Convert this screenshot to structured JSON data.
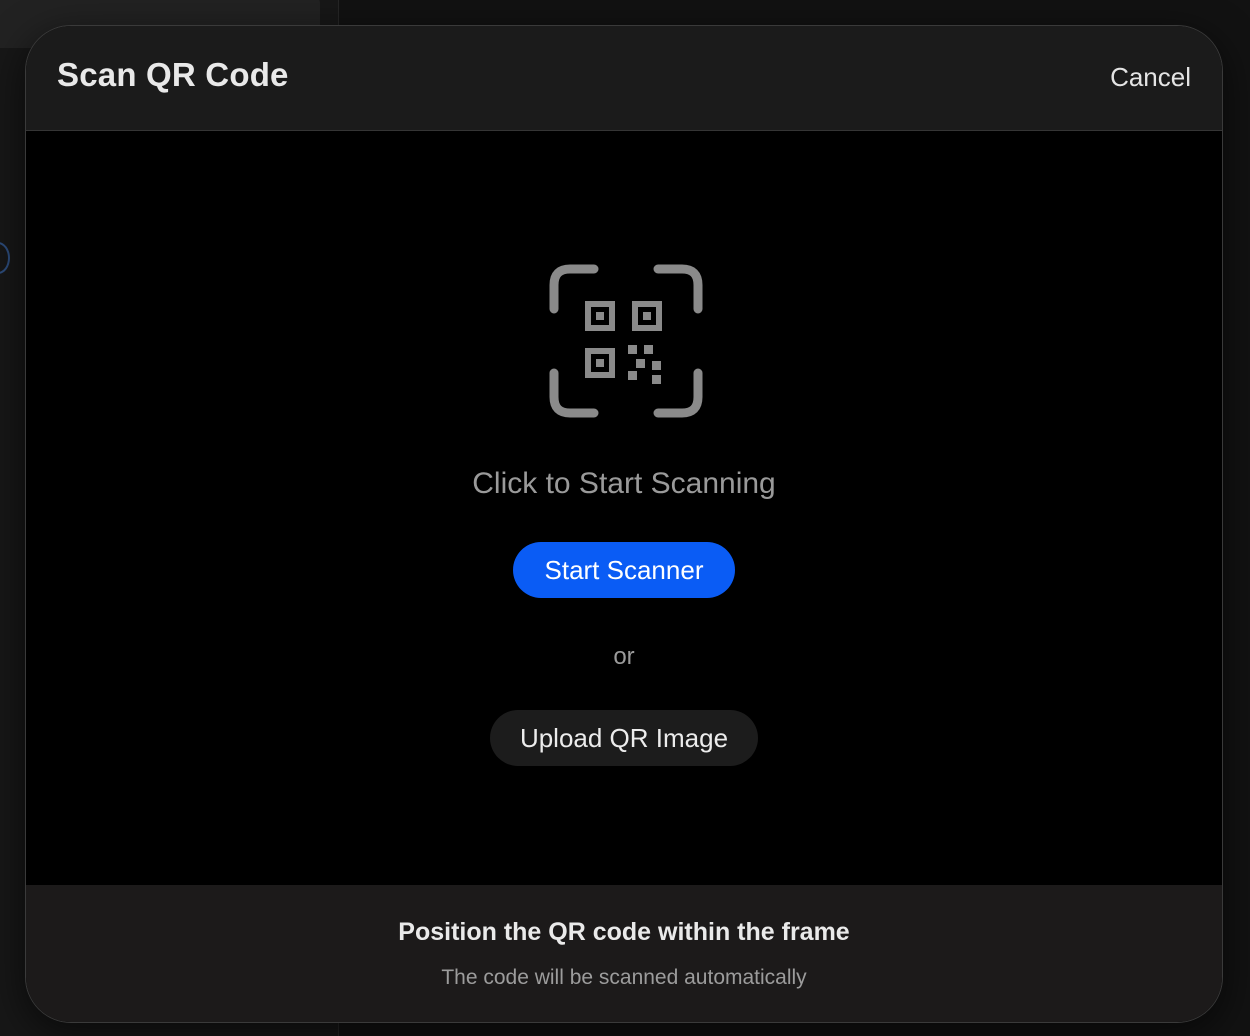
{
  "modal": {
    "title": "Scan QR Code",
    "cancel_label": "Cancel"
  },
  "scanner": {
    "icon": "qr-scan-icon",
    "prompt": "Click to Start Scanning",
    "start_label": "Start Scanner",
    "or_label": "or",
    "upload_label": "Upload QR Image"
  },
  "footer": {
    "title": "Position the QR code within the frame",
    "subtitle": "The code will be scanned automatically"
  },
  "colors": {
    "accent": "#0a5cf5",
    "modal_bg": "#000000",
    "header_bg": "#1b1b1b",
    "footer_bg": "#1c1a1a"
  }
}
